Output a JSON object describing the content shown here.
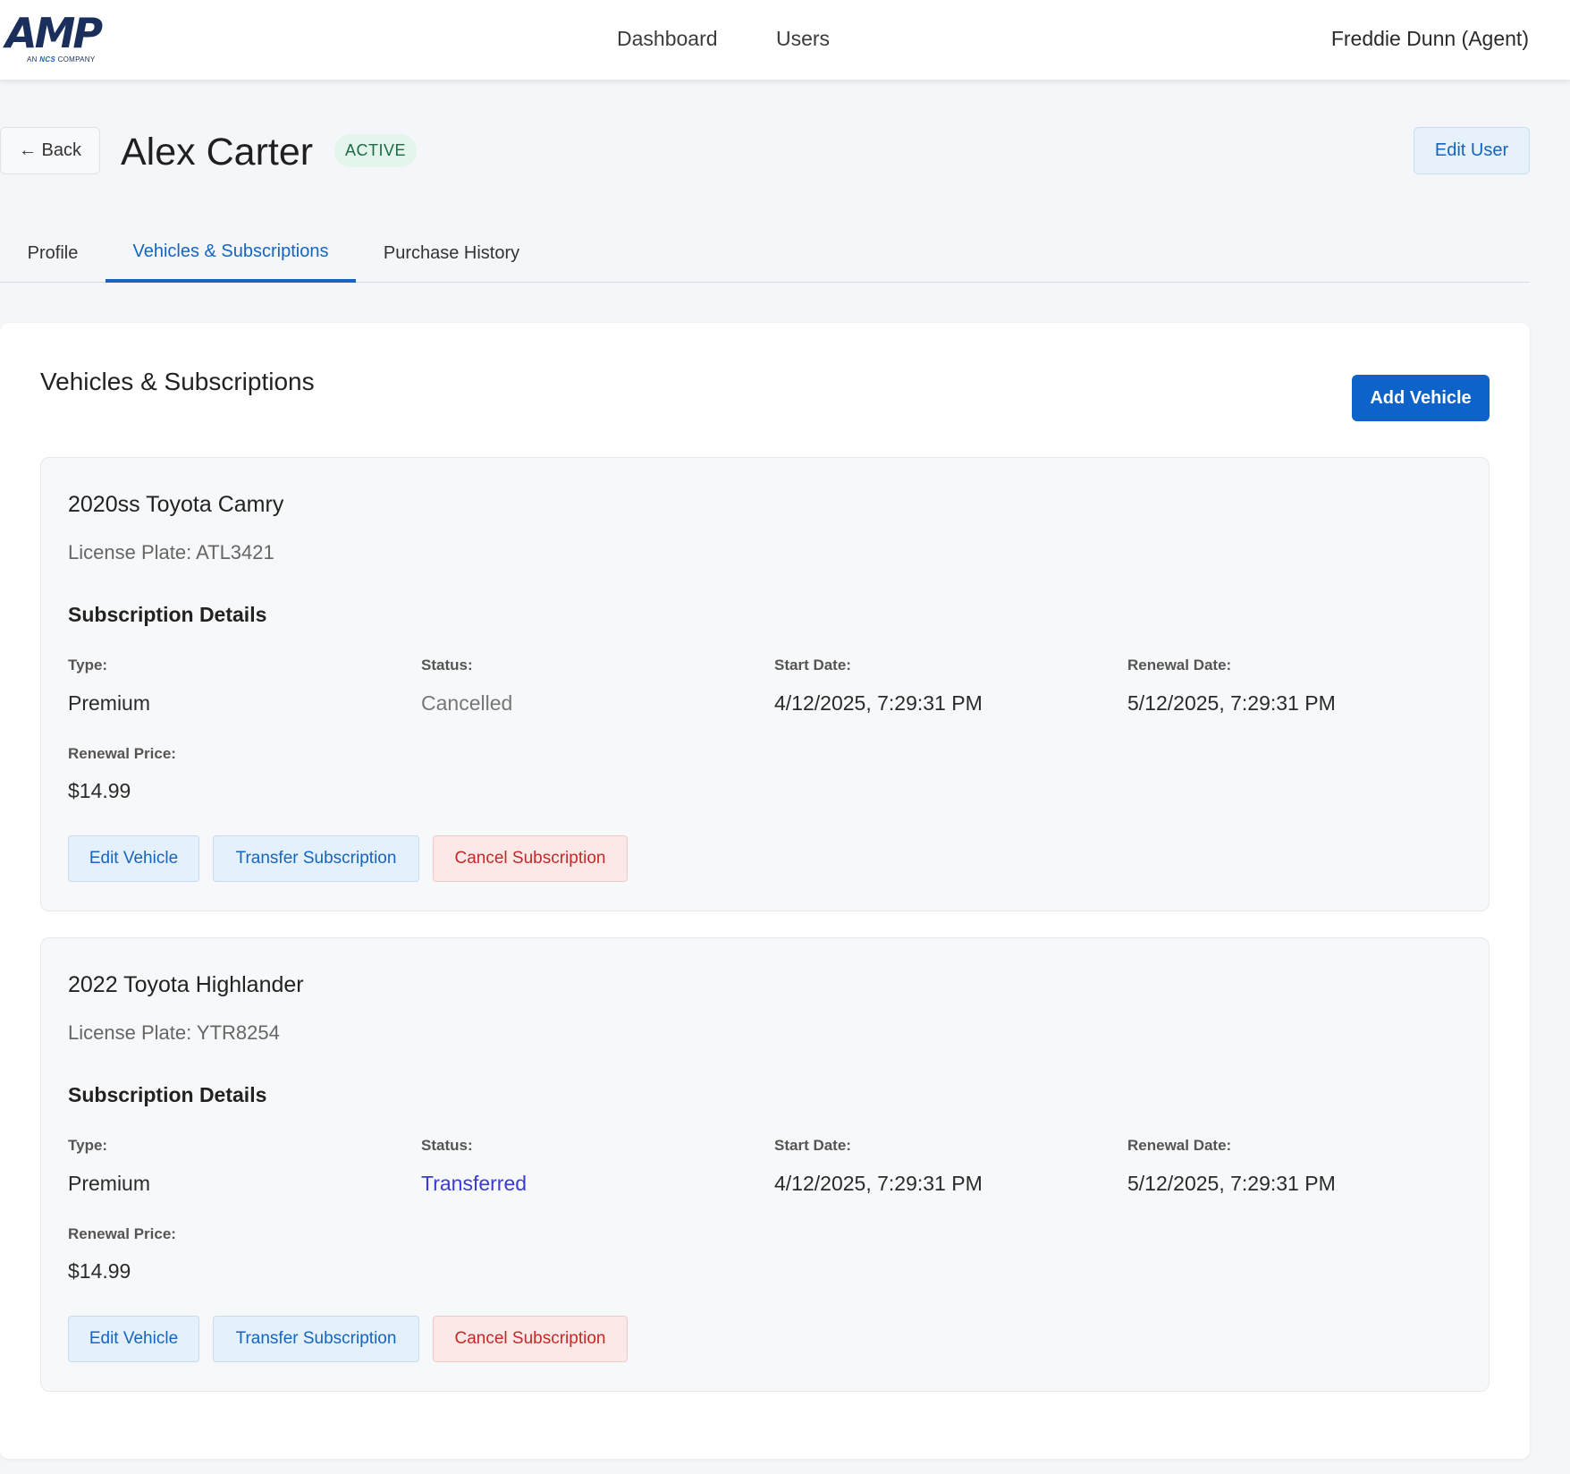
{
  "header": {
    "logo_text": "AMP",
    "logo_sub_prefix": "AN ",
    "logo_sub_brand": "NCS",
    "logo_sub_suffix": " COMPANY",
    "nav": [
      {
        "label": "Dashboard"
      },
      {
        "label": "Users"
      }
    ],
    "user_name": "Freddie Dunn (Agent)"
  },
  "page": {
    "back_label": "← Back",
    "title": "Alex Carter",
    "status_badge": "ACTIVE",
    "edit_user_label": "Edit User"
  },
  "tabs": [
    {
      "label": "Profile",
      "active": false
    },
    {
      "label": "Vehicles & Subscriptions",
      "active": true
    },
    {
      "label": "Purchase History",
      "active": false
    }
  ],
  "section": {
    "title": "Vehicles & Subscriptions",
    "add_vehicle_label": "Add Vehicle"
  },
  "labels": {
    "subscription_details": "Subscription Details",
    "type": "Type:",
    "status": "Status:",
    "start_date": "Start Date:",
    "renewal_date": "Renewal Date:",
    "renewal_price": "Renewal Price:",
    "edit_vehicle": "Edit Vehicle",
    "transfer_subscription": "Transfer Subscription",
    "cancel_subscription": "Cancel Subscription"
  },
  "vehicles": [
    {
      "name": "2020ss Toyota Camry",
      "license_plate": "License Plate: ATL3421",
      "type": "Premium",
      "status": "Cancelled",
      "start_date": "4/12/2025, 7:29:31 PM",
      "renewal_date": "5/12/2025, 7:29:31 PM",
      "renewal_price": "$14.99"
    },
    {
      "name": "2022 Toyota Highlander",
      "license_plate": "License Plate: YTR8254",
      "type": "Premium",
      "status": "Transferred",
      "start_date": "4/12/2025, 7:29:31 PM",
      "renewal_date": "5/12/2025, 7:29:31 PM",
      "renewal_price": "$14.99"
    }
  ],
  "colors": {
    "primary": "#0d63c9",
    "link_blue": "#1565c0",
    "danger": "#c62828",
    "status_transferred": "#3a3ad4",
    "badge_green": "#1d6b45"
  }
}
